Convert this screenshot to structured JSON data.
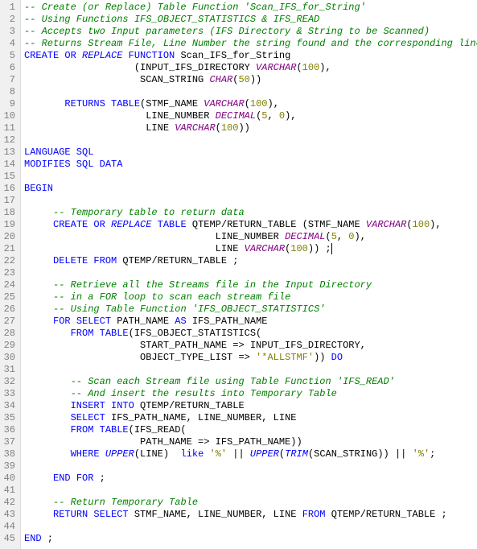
{
  "gutter": {
    "start": 1,
    "end": 45
  },
  "lines": {
    "l1": [
      {
        "cls": "c",
        "t": "-- Create (or Replace) Table Function 'Scan_IFS_for_String'"
      }
    ],
    "l2": [
      {
        "cls": "c",
        "t": "-- Using Functions IFS_OBJECT_STATISTICS & IFS_READ"
      }
    ],
    "l3": [
      {
        "cls": "c",
        "t": "-- Accepts two Input parameters (IFS Directory & String to be Scanned)"
      }
    ],
    "l4": [
      {
        "cls": "c",
        "t": "-- Returns Stream File, Line Number the string found and the corresponding line."
      }
    ],
    "l5": [
      {
        "cls": "k",
        "t": "CREATE OR "
      },
      {
        "cls": "ki",
        "t": "REPLACE"
      },
      {
        "cls": "k",
        "t": " FUNCTION"
      },
      {
        "cls": "id",
        "t": " Scan_IFS_for_String"
      }
    ],
    "l6": [
      {
        "cls": "id",
        "t": "                   (INPUT_IFS_DIRECTORY "
      },
      {
        "cls": "t",
        "t": "VARCHAR"
      },
      {
        "cls": "id",
        "t": "("
      },
      {
        "cls": "n",
        "t": "100"
      },
      {
        "cls": "id",
        "t": "),"
      }
    ],
    "l7": [
      {
        "cls": "id",
        "t": "                    SCAN_STRING "
      },
      {
        "cls": "t",
        "t": "CHAR"
      },
      {
        "cls": "id",
        "t": "("
      },
      {
        "cls": "n",
        "t": "50"
      },
      {
        "cls": "id",
        "t": "))"
      }
    ],
    "l8": [
      {
        "cls": "id",
        "t": ""
      }
    ],
    "l9": [
      {
        "cls": "id",
        "t": "       "
      },
      {
        "cls": "k",
        "t": "RETURNS TABLE"
      },
      {
        "cls": "id",
        "t": "(STMF_NAME "
      },
      {
        "cls": "t",
        "t": "VARCHAR"
      },
      {
        "cls": "id",
        "t": "("
      },
      {
        "cls": "n",
        "t": "100"
      },
      {
        "cls": "id",
        "t": "),"
      }
    ],
    "l10": [
      {
        "cls": "id",
        "t": "                     LINE_NUMBER "
      },
      {
        "cls": "t",
        "t": "DECIMAL"
      },
      {
        "cls": "id",
        "t": "("
      },
      {
        "cls": "n",
        "t": "5"
      },
      {
        "cls": "id",
        "t": ", "
      },
      {
        "cls": "n",
        "t": "0"
      },
      {
        "cls": "id",
        "t": "),"
      }
    ],
    "l11": [
      {
        "cls": "id",
        "t": "                     LINE "
      },
      {
        "cls": "t",
        "t": "VARCHAR"
      },
      {
        "cls": "id",
        "t": "("
      },
      {
        "cls": "n",
        "t": "100"
      },
      {
        "cls": "id",
        "t": "))"
      }
    ],
    "l12": [
      {
        "cls": "id",
        "t": ""
      }
    ],
    "l13": [
      {
        "cls": "k",
        "t": "LANGUAGE SQL"
      }
    ],
    "l14": [
      {
        "cls": "k",
        "t": "MODIFIES SQL DATA"
      }
    ],
    "l15": [
      {
        "cls": "id",
        "t": ""
      }
    ],
    "l16": [
      {
        "cls": "k",
        "t": "BEGIN"
      }
    ],
    "l17": [
      {
        "cls": "id",
        "t": ""
      }
    ],
    "l18": [
      {
        "cls": "id",
        "t": "     "
      },
      {
        "cls": "c",
        "t": "-- Temporary table to return data"
      }
    ],
    "l19": [
      {
        "cls": "id",
        "t": "     "
      },
      {
        "cls": "k",
        "t": "CREATE OR "
      },
      {
        "cls": "ki",
        "t": "REPLACE"
      },
      {
        "cls": "k",
        "t": " TABLE"
      },
      {
        "cls": "id",
        "t": " QTEMP/RETURN_TABLE (STMF_NAME "
      },
      {
        "cls": "t",
        "t": "VARCHAR"
      },
      {
        "cls": "id",
        "t": "("
      },
      {
        "cls": "n",
        "t": "100"
      },
      {
        "cls": "id",
        "t": "),"
      }
    ],
    "l20": [
      {
        "cls": "id",
        "t": "                                 LINE_NUMBER "
      },
      {
        "cls": "t",
        "t": "DECIMAL"
      },
      {
        "cls": "id",
        "t": "("
      },
      {
        "cls": "n",
        "t": "5"
      },
      {
        "cls": "id",
        "t": ", "
      },
      {
        "cls": "n",
        "t": "0"
      },
      {
        "cls": "id",
        "t": "),"
      }
    ],
    "l21": [
      {
        "cls": "id",
        "t": "                                 LINE "
      },
      {
        "cls": "t",
        "t": "VARCHAR"
      },
      {
        "cls": "id",
        "t": "("
      },
      {
        "cls": "n",
        "t": "100"
      },
      {
        "cls": "id",
        "t": ")) ;"
      },
      {
        "cls": "cursor",
        "t": ""
      }
    ],
    "l22": [
      {
        "cls": "id",
        "t": "     "
      },
      {
        "cls": "k",
        "t": "DELETE FROM"
      },
      {
        "cls": "id",
        "t": " QTEMP/RETURN_TABLE ;"
      }
    ],
    "l23": [
      {
        "cls": "id",
        "t": ""
      }
    ],
    "l24": [
      {
        "cls": "id",
        "t": "     "
      },
      {
        "cls": "c",
        "t": "-- Retrieve all the Streams file in the Input Directory"
      }
    ],
    "l25": [
      {
        "cls": "id",
        "t": "     "
      },
      {
        "cls": "c",
        "t": "-- in a FOR loop to scan each stream file"
      }
    ],
    "l26": [
      {
        "cls": "id",
        "t": "     "
      },
      {
        "cls": "c",
        "t": "-- Using Table Function 'IFS_OBJECT_STATISTICS'"
      }
    ],
    "l27": [
      {
        "cls": "id",
        "t": "     "
      },
      {
        "cls": "k",
        "t": "FOR SELECT"
      },
      {
        "cls": "id",
        "t": " PATH_NAME "
      },
      {
        "cls": "k",
        "t": "AS"
      },
      {
        "cls": "id",
        "t": " IFS_PATH_NAME"
      }
    ],
    "l28": [
      {
        "cls": "id",
        "t": "        "
      },
      {
        "cls": "k",
        "t": "FROM TABLE"
      },
      {
        "cls": "id",
        "t": "(IFS_OBJECT_STATISTICS("
      }
    ],
    "l29": [
      {
        "cls": "id",
        "t": "                    START_PATH_NAME => INPUT_IFS_DIRECTORY,"
      }
    ],
    "l30": [
      {
        "cls": "id",
        "t": "                    OBJECT_TYPE_LIST => "
      },
      {
        "cls": "s",
        "t": "'*ALLSTMF'"
      },
      {
        "cls": "id",
        "t": ")) "
      },
      {
        "cls": "k",
        "t": "DO"
      }
    ],
    "l31": [
      {
        "cls": "id",
        "t": ""
      }
    ],
    "l32": [
      {
        "cls": "id",
        "t": "        "
      },
      {
        "cls": "c",
        "t": "-- Scan each Stream file using Table Function 'IFS_READ'"
      }
    ],
    "l33": [
      {
        "cls": "id",
        "t": "        "
      },
      {
        "cls": "c",
        "t": "-- And insert the results into Temporary Table"
      }
    ],
    "l34": [
      {
        "cls": "id",
        "t": "        "
      },
      {
        "cls": "k",
        "t": "INSERT INTO"
      },
      {
        "cls": "id",
        "t": " QTEMP/RETURN_TABLE"
      }
    ],
    "l35": [
      {
        "cls": "id",
        "t": "        "
      },
      {
        "cls": "k",
        "t": "SELECT"
      },
      {
        "cls": "id",
        "t": " IFS_PATH_NAME, LINE_NUMBER, LINE"
      }
    ],
    "l36": [
      {
        "cls": "id",
        "t": "        "
      },
      {
        "cls": "k",
        "t": "FROM TABLE"
      },
      {
        "cls": "id",
        "t": "(IFS_READ("
      }
    ],
    "l37": [
      {
        "cls": "id",
        "t": "                    PATH_NAME => IFS_PATH_NAME))"
      }
    ],
    "l38": [
      {
        "cls": "id",
        "t": "        "
      },
      {
        "cls": "k",
        "t": "WHERE "
      },
      {
        "cls": "ki",
        "t": "UPPER"
      },
      {
        "cls": "id",
        "t": "(LINE) "
      },
      {
        "cls": "k",
        "t": " like "
      },
      {
        "cls": "s",
        "t": "'%'"
      },
      {
        "cls": "id",
        "t": " || "
      },
      {
        "cls": "ki",
        "t": "UPPER"
      },
      {
        "cls": "id",
        "t": "("
      },
      {
        "cls": "ki",
        "t": "TRIM"
      },
      {
        "cls": "id",
        "t": "(SCAN_STRING)) || "
      },
      {
        "cls": "s",
        "t": "'%'"
      },
      {
        "cls": "id",
        "t": ";"
      }
    ],
    "l39": [
      {
        "cls": "id",
        "t": ""
      }
    ],
    "l40": [
      {
        "cls": "id",
        "t": "     "
      },
      {
        "cls": "k",
        "t": "END FOR"
      },
      {
        "cls": "id",
        "t": " ;"
      }
    ],
    "l41": [
      {
        "cls": "id",
        "t": ""
      }
    ],
    "l42": [
      {
        "cls": "id",
        "t": "     "
      },
      {
        "cls": "c",
        "t": "-- Return Temporary Table"
      }
    ],
    "l43": [
      {
        "cls": "id",
        "t": "     "
      },
      {
        "cls": "k",
        "t": "RETURN SELECT"
      },
      {
        "cls": "id",
        "t": " STMF_NAME, LINE_NUMBER, LINE "
      },
      {
        "cls": "k",
        "t": "FROM"
      },
      {
        "cls": "id",
        "t": " QTEMP/RETURN_TABLE ;"
      }
    ],
    "l44": [
      {
        "cls": "id",
        "t": ""
      }
    ],
    "l45": [
      {
        "cls": "k",
        "t": "END"
      },
      {
        "cls": "id",
        "t": " ;"
      }
    ]
  }
}
